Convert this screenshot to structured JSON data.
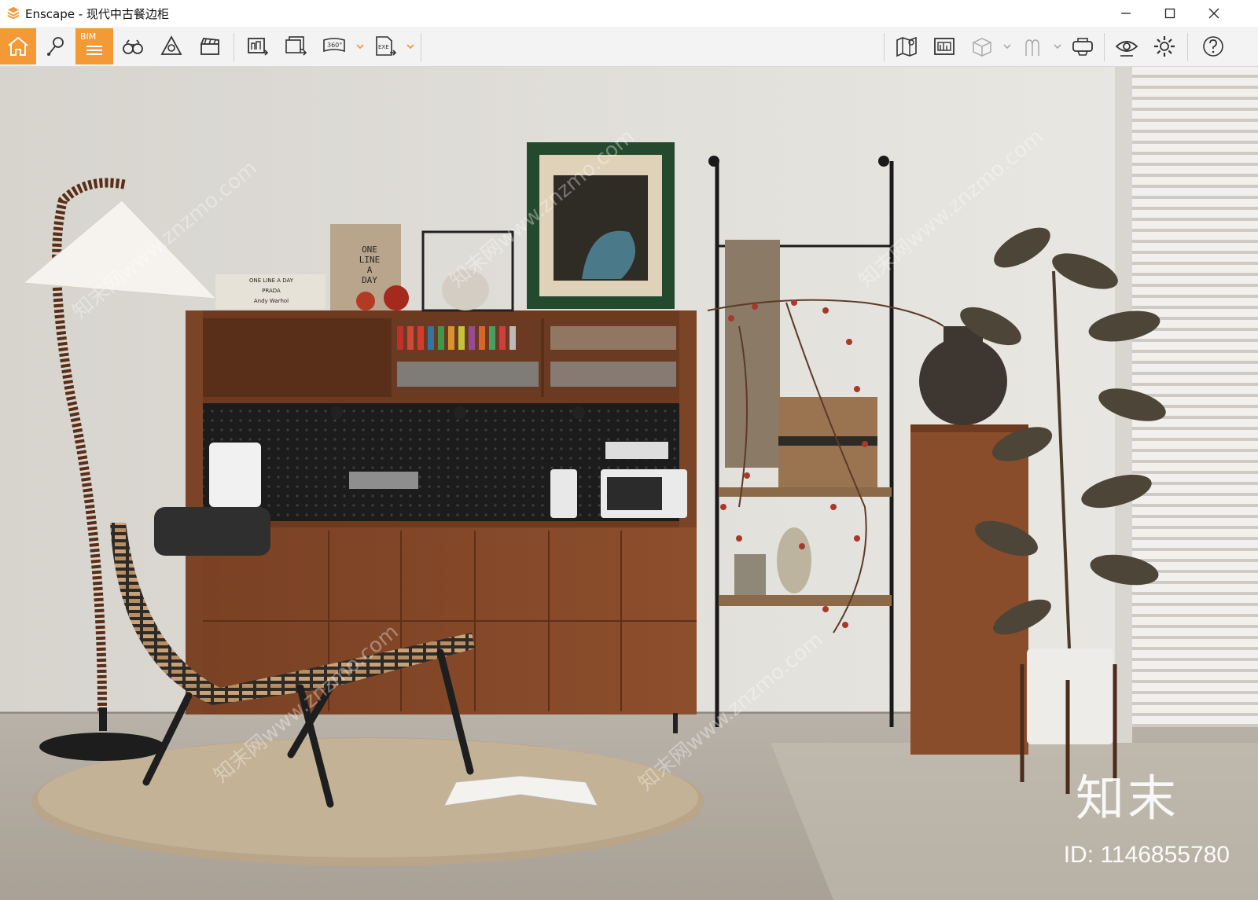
{
  "window": {
    "title": "Enscape - 现代中古餐边柜",
    "controls": [
      "minimize-icon",
      "maximize-icon",
      "close-icon"
    ]
  },
  "toolbar": {
    "accent_color": "#f39a37",
    "left_tools": [
      {
        "name": "home-icon",
        "active": true
      },
      {
        "name": "location-pin-icon",
        "active": false
      },
      {
        "name": "bim-icon",
        "active": true,
        "label": "BIM"
      },
      {
        "name": "binoculars-icon",
        "active": false
      },
      {
        "name": "triangle-capture-icon",
        "active": false
      },
      {
        "name": "clapperboard-icon",
        "active": false
      },
      {
        "name": "render-export-icon",
        "active": false
      },
      {
        "name": "batch-render-icon",
        "active": false
      },
      {
        "name": "panorama-360-icon",
        "active": false,
        "label": "360°"
      },
      {
        "name": "exe-export-icon",
        "active": false,
        "label": "EXE"
      }
    ],
    "right_tools": [
      {
        "name": "map-icon"
      },
      {
        "name": "asset-library-icon"
      },
      {
        "name": "cube-icon"
      },
      {
        "name": "people-icon"
      },
      {
        "name": "vr-headset-icon"
      },
      {
        "name": "eye-icon"
      },
      {
        "name": "settings-icon"
      },
      {
        "name": "help-icon"
      }
    ]
  },
  "scene": {
    "book_spine_text": [
      "ONE",
      "LINE",
      "A",
      "DAY"
    ],
    "book_stack_text": [
      "ONE LINE A DAY",
      "PRADA",
      "Andy Warhol"
    ],
    "watermark_logo": "知末",
    "watermark_id": "ID: 1146855780",
    "watermark_text": "知末网www.znzmo.com"
  }
}
